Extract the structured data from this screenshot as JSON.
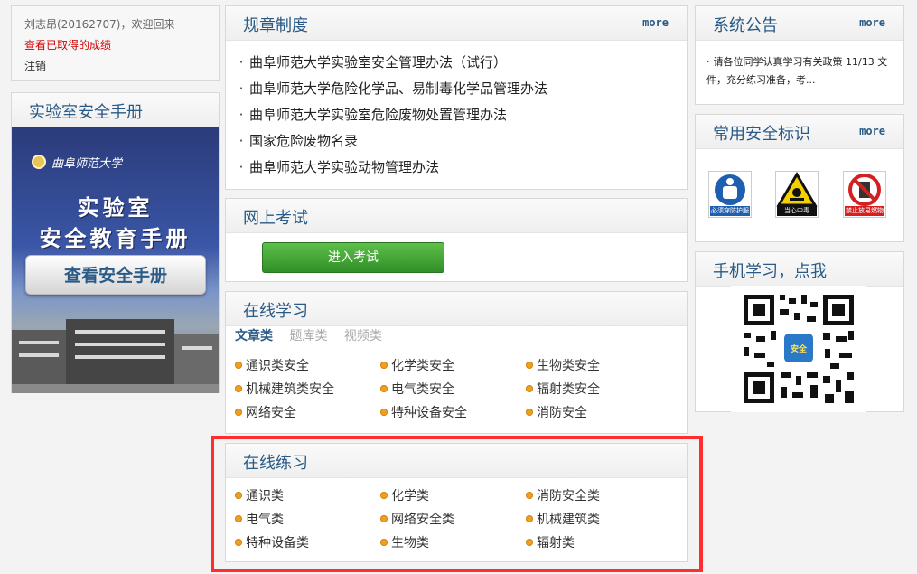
{
  "user": {
    "greeting": "刘志昂(20162707)，欢迎回来",
    "scores_link": "查看已取得的成绩",
    "logout": "注销"
  },
  "handbook": {
    "title": "实验室安全手册",
    "univ_name": "曲阜师范大学",
    "cover_line1": "实验室",
    "cover_line2": "安全教育手册",
    "view_button": "查看安全手册"
  },
  "rules": {
    "title": "规章制度",
    "more": "more",
    "items": [
      "曲阜师范大学实验室安全管理办法（试行）",
      "曲阜师范大学危险化学品、易制毒化学品管理办法",
      "曲阜师范大学实验室危险废物处置管理办法",
      "国家危险废物名录",
      "曲阜师范大学实验动物管理办法"
    ]
  },
  "exam": {
    "title": "网上考试",
    "button": "进入考试"
  },
  "study": {
    "title": "在线学习",
    "tabs": [
      "文章类",
      "题库类",
      "视频类"
    ],
    "categories": [
      "通识类安全",
      "化学类安全",
      "生物类安全",
      "机械建筑类安全",
      "电气类安全",
      "辐射类安全",
      "网络安全",
      "特种设备安全",
      "消防安全"
    ]
  },
  "practice": {
    "title": "在线练习",
    "categories": [
      "通识类",
      "化学类",
      "消防安全类",
      "电气类",
      "网络安全类",
      "机械建筑类",
      "特种设备类",
      "生物类",
      "辐射类"
    ]
  },
  "notice": {
    "title": "系统公告",
    "more": "more",
    "text": "请各位同学认真学习有关政策 11/13 文件，充分练习准备，考..."
  },
  "signs": {
    "title": "常用安全标识",
    "more": "more",
    "items": [
      {
        "label": "必须穿防护服",
        "icon": "protective-clothing-icon",
        "color": "#1f5fb0"
      },
      {
        "label": "当心中毒",
        "icon": "poison-warning-icon",
        "color": "#f5d000"
      },
      {
        "label": "禁止放易燃物",
        "icon": "no-flammables-icon",
        "color": "#d42020"
      }
    ]
  },
  "mobile": {
    "title": "手机学习，点我",
    "qr_center": "安全"
  }
}
